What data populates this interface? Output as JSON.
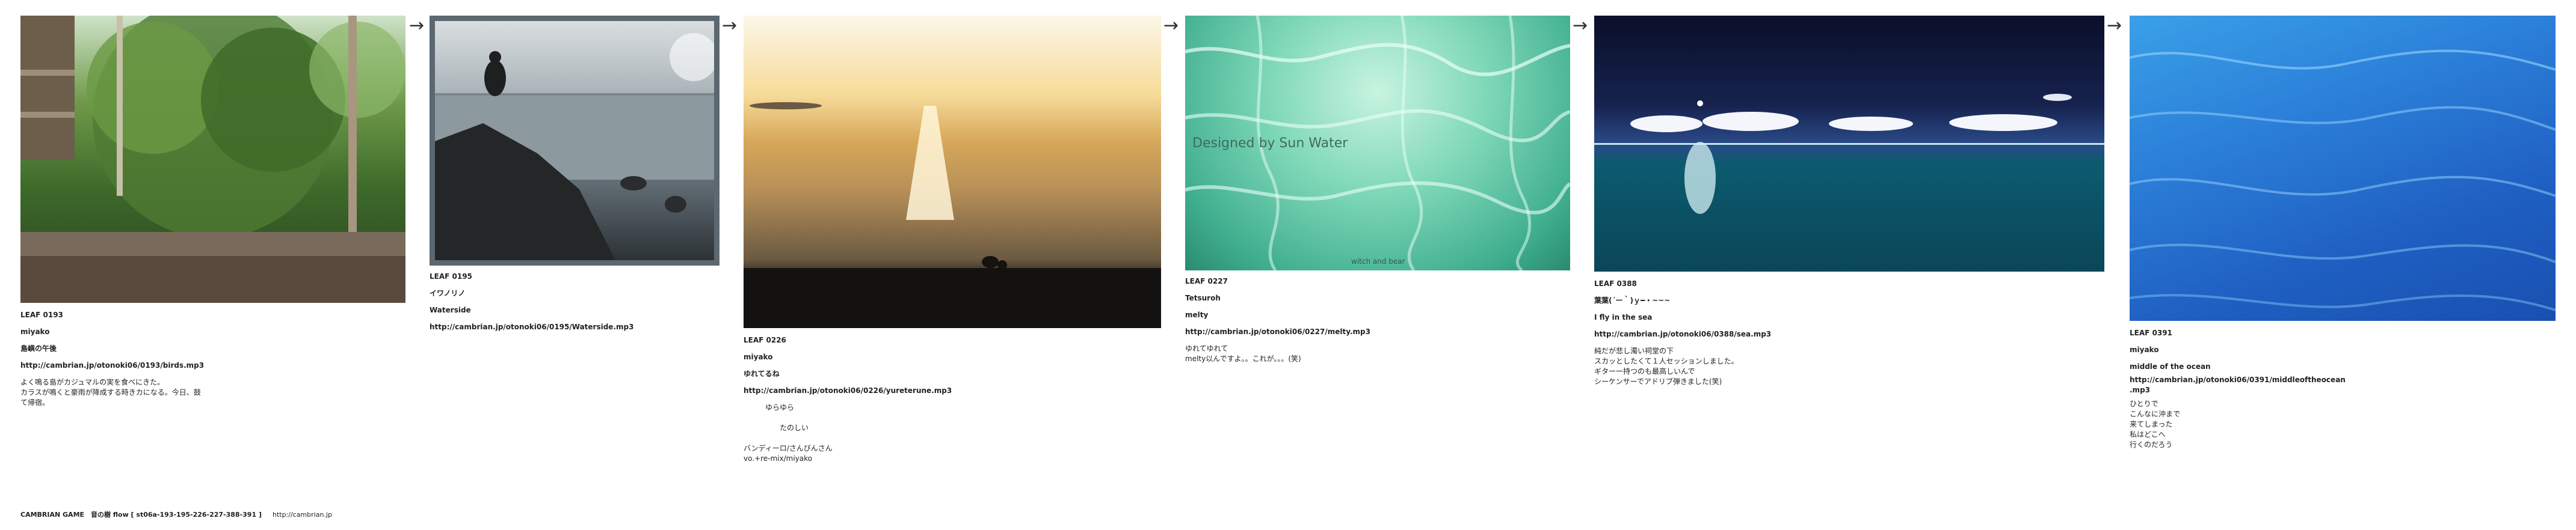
{
  "leaves": [
    {
      "code": "LEAF 0193",
      "author": "miyako",
      "title": "島嶼の午後",
      "url": "http://cambrian.jp/otonoki06/0193/birds.mp3",
      "body": "よく鳴る島がカジュマルの実を食べにきた。\nカラスが鳴くと豪雨が降成する時きカになる。今日、鼓\nて帰宿。"
    },
    {
      "code": "LEAF 0195",
      "author": "イワノリノ",
      "title": "Waterside",
      "url": "http://cambrian.jp/otonoki06/0195/Waterside.mp3",
      "body": ""
    },
    {
      "code": "LEAF 0226",
      "author": "miyako",
      "title": "ゆれてるね",
      "url": "http://cambrian.jp/otonoki06/0226/yureterune.mp3",
      "body": "　　　ゆらゆら\n\n　　　　　たのしい\n\nバンディーロ/さんびんさん\nvo.+re-mix/miyako"
    },
    {
      "code": "LEAF 0227",
      "author": "Tetsuroh",
      "title": "melty",
      "url": "http://cambrian.jp/otonoki06/0227/melty.mp3",
      "body": "ゆれてゆれて\nmelty以んですよ。。これが。。。(笑)"
    },
    {
      "code": "LEAF 0388",
      "author": "葉葉(´ー｀)ｙ━・~~~",
      "title": "I fly in the sea",
      "url": "http://cambrian.jp/otonoki06/0388/sea.mp3",
      "body": "純だが悲し濁い祠堂の下\nスカッとしたくて１人セッションしました。\nギター一持つのも最高しいんで\nシーケンサーでアドリブ弾きました(笑)"
    },
    {
      "code": "LEAF 0391",
      "author": "miyako",
      "title": "middle of the ocean",
      "url": "http://cambrian.jp/otonoki06/0391/middleoftheocean\n.mp3",
      "body": "ひとりで\nこんなに沖まで\n来てしまった\n私はどこへ\n行くのだろう"
    }
  ],
  "overlay_text": {
    "melty_title": "Designed by Sun Water",
    "melty_credit": "witch and bear"
  },
  "arrow_glyph": "→",
  "footer": {
    "text": "CAMBRIAN GAME　音の樹 flow [ st06a-193-195-226-227-388-391 ]",
    "url": "http://cambrian.jp"
  }
}
